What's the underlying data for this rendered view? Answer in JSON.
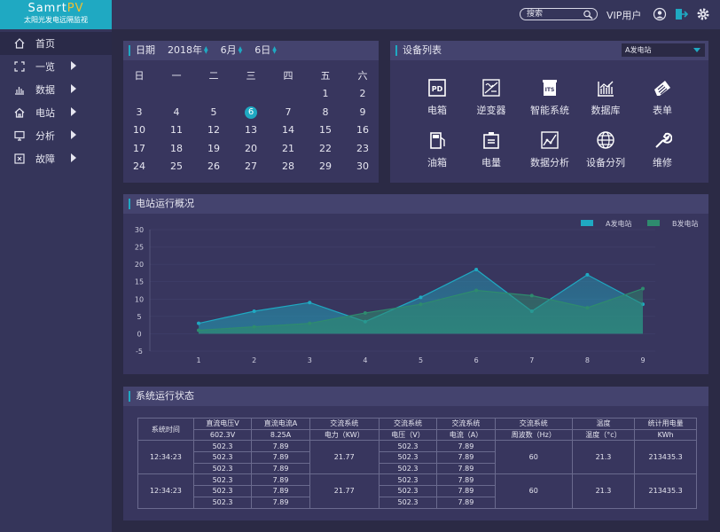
{
  "brand": {
    "name_main": "Samrt",
    "name_accent": "PV",
    "subtitle": "太阳光发电远隔监视"
  },
  "nav": [
    {
      "label": "首页",
      "icon": "home-icon"
    },
    {
      "label": "一览",
      "icon": "frame-icon"
    },
    {
      "label": "数据",
      "icon": "bar-chart-icon"
    },
    {
      "label": "电站",
      "icon": "house-icon"
    },
    {
      "label": "分析",
      "icon": "monitor-icon"
    },
    {
      "label": "故障",
      "icon": "alert-box-icon"
    }
  ],
  "top": {
    "search_placeholder": "搜索",
    "user": "VIP用户"
  },
  "calendar": {
    "title": "日期",
    "year": "2018年",
    "month": "6月",
    "day": "6日",
    "weekdays": [
      "日",
      "一",
      "二",
      "三",
      "四",
      "五",
      "六"
    ],
    "weeks": [
      [
        "",
        "",
        "",
        "",
        "",
        "1",
        "2"
      ],
      [
        "3",
        "4",
        "5",
        "6",
        "7",
        "8",
        "9"
      ],
      [
        "10",
        "11",
        "12",
        "13",
        "14",
        "15",
        "16"
      ],
      [
        "17",
        "18",
        "19",
        "20",
        "21",
        "22",
        "23"
      ],
      [
        "24",
        "25",
        "26",
        "27",
        "28",
        "29",
        "30"
      ]
    ],
    "today": "6"
  },
  "devices": {
    "title": "设备列表",
    "selected": "A发电站",
    "items": [
      {
        "label": "电箱",
        "icon": "pd-icon"
      },
      {
        "label": "逆变器",
        "icon": "inverter-icon"
      },
      {
        "label": "智能系统",
        "icon": "its-icon"
      },
      {
        "label": "数据库",
        "icon": "database-chart-icon"
      },
      {
        "label": "表单",
        "icon": "form-icon"
      },
      {
        "label": "油箱",
        "icon": "fuel-icon"
      },
      {
        "label": "电量",
        "icon": "battery-icon"
      },
      {
        "label": "数据分析",
        "icon": "analysis-icon"
      },
      {
        "label": "设备分列",
        "icon": "globe-icon"
      },
      {
        "label": "维修",
        "icon": "wrench-icon"
      }
    ]
  },
  "overview": {
    "title": "电站运行概况"
  },
  "chart_data": {
    "type": "area",
    "x": [
      1,
      2,
      3,
      4,
      5,
      6,
      7,
      8,
      9
    ],
    "ylim": [
      -5,
      30
    ],
    "yticks": [
      30,
      25,
      20,
      15,
      10,
      5,
      0,
      -5
    ],
    "series": [
      {
        "name": "A发电站",
        "color": "#1fa9c2",
        "values": [
          3,
          6.5,
          9,
          3.5,
          10.5,
          18.5,
          6.5,
          17,
          8.5
        ]
      },
      {
        "name": "B发电站",
        "color": "#2e8b6e",
        "values": [
          1,
          2,
          3,
          6,
          8.5,
          12.5,
          11,
          7.5,
          13
        ]
      }
    ],
    "legend": "top-right"
  },
  "system": {
    "title": "系统运行状态",
    "headers": [
      [
        "系统时间",
        "直流电压V",
        "直流电流A",
        "交流系统",
        "交流系统",
        "交流系统",
        "交流系统",
        "温度",
        "统计用电量"
      ],
      [
        "",
        "602.3V",
        "8.25A",
        "电力（KW）",
        "电压（V）",
        "电流（A）",
        "周波数（Hz）",
        "温度（°c）",
        "KWh"
      ]
    ],
    "groups": [
      {
        "time": "12:34:23",
        "power": "21.77",
        "freq": "60",
        "temp": "21.3",
        "kwh": "213435.3",
        "rows": [
          [
            "502.3",
            "7.89",
            "502.3",
            "7.89"
          ],
          [
            "502.3",
            "7.89",
            "502.3",
            "7.89"
          ],
          [
            "502.3",
            "7.89",
            "502.3",
            "7.89"
          ]
        ]
      },
      {
        "time": "12:34:23",
        "power": "21.77",
        "freq": "60",
        "temp": "21.3",
        "kwh": "213435.3",
        "rows": [
          [
            "502.3",
            "7.89",
            "502.3",
            "7.89"
          ],
          [
            "502.3",
            "7.89",
            "502.3",
            "7.89"
          ],
          [
            "502.3",
            "7.89",
            "502.3",
            "7.89"
          ]
        ]
      }
    ]
  }
}
